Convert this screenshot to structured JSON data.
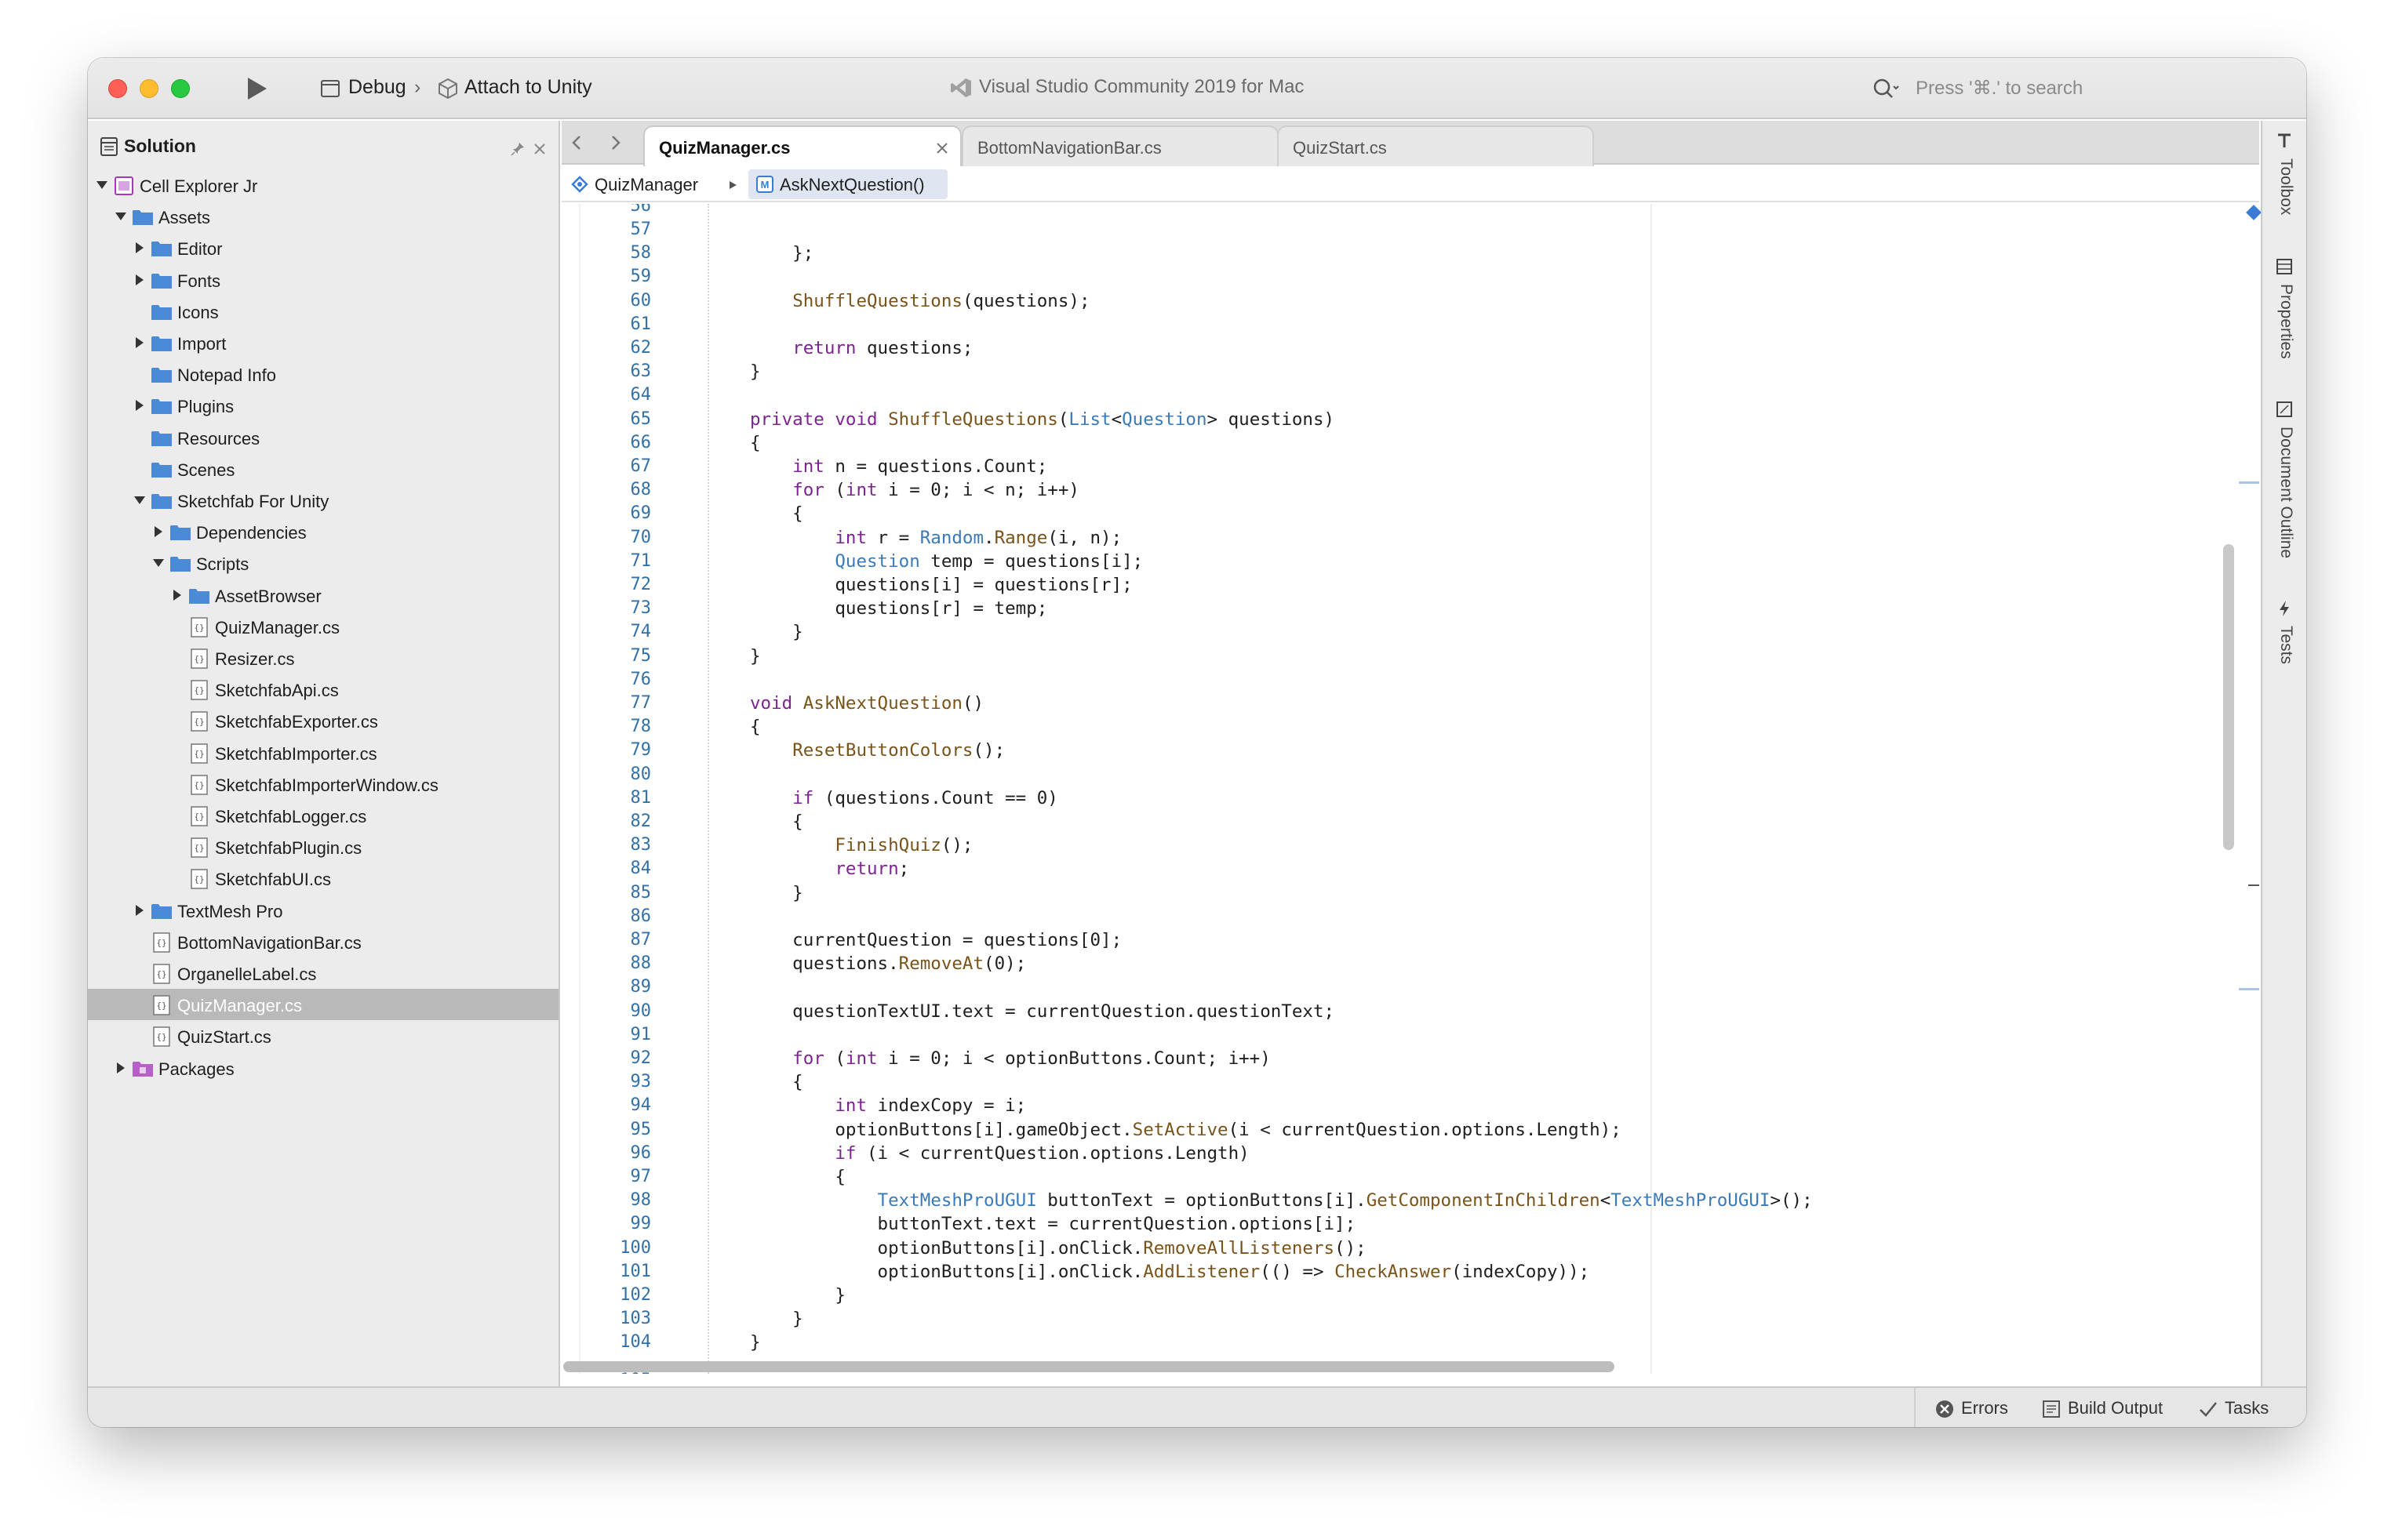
{
  "titlebar": {
    "configuration": "Debug",
    "separator": "›",
    "target": "Attach to Unity",
    "app_title": "Visual Studio Community 2019 for Mac",
    "search_placeholder": "Press '⌘.' to search"
  },
  "solution": {
    "title": "Solution",
    "tree": [
      {
        "label": "Cell Explorer Jr",
        "level": 0,
        "kind": "project",
        "expanded": true
      },
      {
        "label": "Assets",
        "level": 1,
        "kind": "folder",
        "expanded": true
      },
      {
        "label": "Editor",
        "level": 2,
        "kind": "folder",
        "expanded": false
      },
      {
        "label": "Fonts",
        "level": 2,
        "kind": "folder",
        "expanded": false
      },
      {
        "label": "Icons",
        "level": 2,
        "kind": "folder",
        "expanded": null
      },
      {
        "label": "Import",
        "level": 2,
        "kind": "folder",
        "expanded": false
      },
      {
        "label": "Notepad Info",
        "level": 2,
        "kind": "folder",
        "expanded": null
      },
      {
        "label": "Plugins",
        "level": 2,
        "kind": "folder",
        "expanded": false
      },
      {
        "label": "Resources",
        "level": 2,
        "kind": "folder",
        "expanded": null
      },
      {
        "label": "Scenes",
        "level": 2,
        "kind": "folder",
        "expanded": null
      },
      {
        "label": "Sketchfab For Unity",
        "level": 2,
        "kind": "folder",
        "expanded": true
      },
      {
        "label": "Dependencies",
        "level": 3,
        "kind": "folder",
        "expanded": false
      },
      {
        "label": "Scripts",
        "level": 3,
        "kind": "folder",
        "expanded": true
      },
      {
        "label": "AssetBrowser",
        "level": 4,
        "kind": "folder",
        "expanded": false
      },
      {
        "label": "QuizManager.cs",
        "level": 4,
        "kind": "file",
        "expanded": null
      },
      {
        "label": "Resizer.cs",
        "level": 4,
        "kind": "file",
        "expanded": null
      },
      {
        "label": "SketchfabApi.cs",
        "level": 4,
        "kind": "file",
        "expanded": null
      },
      {
        "label": "SketchfabExporter.cs",
        "level": 4,
        "kind": "file",
        "expanded": null
      },
      {
        "label": "SketchfabImporter.cs",
        "level": 4,
        "kind": "file",
        "expanded": null
      },
      {
        "label": "SketchfabImporterWindow.cs",
        "level": 4,
        "kind": "file",
        "expanded": null
      },
      {
        "label": "SketchfabLogger.cs",
        "level": 4,
        "kind": "file",
        "expanded": null
      },
      {
        "label": "SketchfabPlugin.cs",
        "level": 4,
        "kind": "file",
        "expanded": null
      },
      {
        "label": "SketchfabUI.cs",
        "level": 4,
        "kind": "file",
        "expanded": null
      },
      {
        "label": "TextMesh Pro",
        "level": 2,
        "kind": "folder",
        "expanded": false
      },
      {
        "label": "BottomNavigationBar.cs",
        "level": 2,
        "kind": "file",
        "expanded": null
      },
      {
        "label": "OrganelleLabel.cs",
        "level": 2,
        "kind": "file",
        "expanded": null
      },
      {
        "label": "QuizManager.cs",
        "level": 2,
        "kind": "file",
        "expanded": null,
        "selected": true
      },
      {
        "label": "QuizStart.cs",
        "level": 2,
        "kind": "file",
        "expanded": null
      },
      {
        "label": "Packages",
        "level": 1,
        "kind": "packages",
        "expanded": false
      }
    ]
  },
  "tabs": [
    {
      "label": "QuizManager.cs",
      "active": true
    },
    {
      "label": "BottomNavigationBar.cs",
      "active": false
    },
    {
      "label": "QuizStart.cs",
      "active": false
    }
  ],
  "breadcrumb": {
    "class_name": "QuizManager",
    "method_name": "AskNextQuestion()"
  },
  "code": {
    "first_partial_line": "56",
    "last_partial_line": "105",
    "lines": [
      {
        "n": "57",
        "t": []
      },
      {
        "n": "58",
        "t": [
          [
            "p",
            "        };"
          ]
        ]
      },
      {
        "n": "59",
        "t": []
      },
      {
        "n": "60",
        "t": [
          [
            "p",
            "        "
          ],
          [
            "f",
            "ShuffleQuestions"
          ],
          [
            "p",
            "(questions);"
          ]
        ]
      },
      {
        "n": "61",
        "t": []
      },
      {
        "n": "62",
        "t": [
          [
            "p",
            "        "
          ],
          [
            "k",
            "return"
          ],
          [
            "p",
            " questions;"
          ]
        ]
      },
      {
        "n": "63",
        "t": [
          [
            "p",
            "    }"
          ]
        ]
      },
      {
        "n": "64",
        "t": []
      },
      {
        "n": "65",
        "t": [
          [
            "p",
            "    "
          ],
          [
            "k",
            "private"
          ],
          [
            "p",
            " "
          ],
          [
            "k",
            "void"
          ],
          [
            "p",
            " "
          ],
          [
            "f",
            "ShuffleQuestions"
          ],
          [
            "p",
            "("
          ],
          [
            "y",
            "List"
          ],
          [
            "p",
            "<"
          ],
          [
            "y",
            "Question"
          ],
          [
            "p",
            "> questions)"
          ]
        ]
      },
      {
        "n": "66",
        "t": [
          [
            "p",
            "    {"
          ]
        ]
      },
      {
        "n": "67",
        "t": [
          [
            "p",
            "        "
          ],
          [
            "k",
            "int"
          ],
          [
            "p",
            " n = questions.Count;"
          ]
        ]
      },
      {
        "n": "68",
        "t": [
          [
            "p",
            "        "
          ],
          [
            "k",
            "for"
          ],
          [
            "p",
            " ("
          ],
          [
            "k",
            "int"
          ],
          [
            "p",
            " i = 0; i < n; i++)"
          ]
        ]
      },
      {
        "n": "69",
        "t": [
          [
            "p",
            "        {"
          ]
        ]
      },
      {
        "n": "70",
        "t": [
          [
            "p",
            "            "
          ],
          [
            "k",
            "int"
          ],
          [
            "p",
            " r = "
          ],
          [
            "y",
            "Random"
          ],
          [
            "p",
            "."
          ],
          [
            "f",
            "Range"
          ],
          [
            "p",
            "(i, n);"
          ]
        ]
      },
      {
        "n": "71",
        "t": [
          [
            "p",
            "            "
          ],
          [
            "y",
            "Question"
          ],
          [
            "p",
            " temp = questions[i];"
          ]
        ]
      },
      {
        "n": "72",
        "t": [
          [
            "p",
            "            questions[i] = questions[r];"
          ]
        ]
      },
      {
        "n": "73",
        "t": [
          [
            "p",
            "            questions[r] = temp;"
          ]
        ]
      },
      {
        "n": "74",
        "t": [
          [
            "p",
            "        }"
          ]
        ]
      },
      {
        "n": "75",
        "t": [
          [
            "p",
            "    }"
          ]
        ]
      },
      {
        "n": "76",
        "t": []
      },
      {
        "n": "77",
        "t": [
          [
            "p",
            "    "
          ],
          [
            "k",
            "void"
          ],
          [
            "p",
            " "
          ],
          [
            "f",
            "AskNextQuestion"
          ],
          [
            "p",
            "()"
          ]
        ]
      },
      {
        "n": "78",
        "t": [
          [
            "p",
            "    {"
          ]
        ]
      },
      {
        "n": "79",
        "t": [
          [
            "p",
            "        "
          ],
          [
            "f",
            "ResetButtonColors"
          ],
          [
            "p",
            "();"
          ]
        ]
      },
      {
        "n": "80",
        "t": []
      },
      {
        "n": "81",
        "t": [
          [
            "p",
            "        "
          ],
          [
            "k",
            "if"
          ],
          [
            "p",
            " (questions.Count == 0)"
          ]
        ]
      },
      {
        "n": "82",
        "t": [
          [
            "p",
            "        {"
          ]
        ]
      },
      {
        "n": "83",
        "t": [
          [
            "p",
            "            "
          ],
          [
            "f",
            "FinishQuiz"
          ],
          [
            "p",
            "();"
          ]
        ]
      },
      {
        "n": "84",
        "t": [
          [
            "p",
            "            "
          ],
          [
            "k",
            "return"
          ],
          [
            "p",
            ";"
          ]
        ]
      },
      {
        "n": "85",
        "t": [
          [
            "p",
            "        }"
          ]
        ]
      },
      {
        "n": "86",
        "t": []
      },
      {
        "n": "87",
        "t": [
          [
            "p",
            "        currentQuestion = questions[0];"
          ]
        ]
      },
      {
        "n": "88",
        "t": [
          [
            "p",
            "        questions."
          ],
          [
            "f",
            "RemoveAt"
          ],
          [
            "p",
            "(0);"
          ]
        ]
      },
      {
        "n": "89",
        "t": []
      },
      {
        "n": "90",
        "t": [
          [
            "p",
            "        questionTextUI.text = currentQuestion.questionText;"
          ]
        ]
      },
      {
        "n": "91",
        "t": []
      },
      {
        "n": "92",
        "t": [
          [
            "p",
            "        "
          ],
          [
            "k",
            "for"
          ],
          [
            "p",
            " ("
          ],
          [
            "k",
            "int"
          ],
          [
            "p",
            " i = 0; i < optionButtons.Count; i++)"
          ]
        ]
      },
      {
        "n": "93",
        "t": [
          [
            "p",
            "        {"
          ]
        ]
      },
      {
        "n": "94",
        "t": [
          [
            "p",
            "            "
          ],
          [
            "k",
            "int"
          ],
          [
            "p",
            " indexCopy = i;"
          ]
        ]
      },
      {
        "n": "95",
        "t": [
          [
            "p",
            "            optionButtons[i].gameObject."
          ],
          [
            "f",
            "SetActive"
          ],
          [
            "p",
            "(i < currentQuestion.options.Length);"
          ]
        ]
      },
      {
        "n": "96",
        "t": [
          [
            "p",
            "            "
          ],
          [
            "k",
            "if"
          ],
          [
            "p",
            " (i < currentQuestion.options.Length)"
          ]
        ]
      },
      {
        "n": "97",
        "t": [
          [
            "p",
            "            {"
          ]
        ]
      },
      {
        "n": "98",
        "t": [
          [
            "p",
            "                "
          ],
          [
            "y",
            "TextMeshProUGUI"
          ],
          [
            "p",
            " buttonText = optionButtons[i]."
          ],
          [
            "f",
            "GetComponentInChildren"
          ],
          [
            "p",
            "<"
          ],
          [
            "y",
            "TextMeshProUGUI"
          ],
          [
            "p",
            ">();"
          ]
        ]
      },
      {
        "n": "99",
        "t": [
          [
            "p",
            "                buttonText.text = currentQuestion.options[i];"
          ]
        ]
      },
      {
        "n": "100",
        "t": [
          [
            "p",
            "                optionButtons[i].onClick."
          ],
          [
            "f",
            "RemoveAllListeners"
          ],
          [
            "p",
            "();"
          ]
        ]
      },
      {
        "n": "101",
        "t": [
          [
            "p",
            "                optionButtons[i].onClick."
          ],
          [
            "f",
            "AddListener"
          ],
          [
            "p",
            "(() => "
          ],
          [
            "f",
            "CheckAnswer"
          ],
          [
            "p",
            "(indexCopy));"
          ]
        ]
      },
      {
        "n": "102",
        "t": [
          [
            "p",
            "            }"
          ]
        ]
      },
      {
        "n": "103",
        "t": [
          [
            "p",
            "        }"
          ]
        ]
      },
      {
        "n": "104",
        "t": [
          [
            "p",
            "    }"
          ]
        ]
      }
    ]
  },
  "toolstrip": {
    "items": [
      {
        "label": "Toolbox",
        "icon": "toolbox-icon"
      },
      {
        "label": "Properties",
        "icon": "properties-icon"
      },
      {
        "label": "Document Outline",
        "icon": "document-outline-icon"
      },
      {
        "label": "Tests",
        "icon": "tests-icon"
      }
    ]
  },
  "statusbar": {
    "errors_label": "Errors",
    "build_output_label": "Build Output",
    "tasks_label": "Tasks"
  },
  "colors": {
    "keyword": "#7c2391",
    "type": "#3a7ab8",
    "method": "#7a5319",
    "line_number": "#3271a7",
    "folder": "#4a8ad6",
    "selection": "#b9b9b9"
  }
}
